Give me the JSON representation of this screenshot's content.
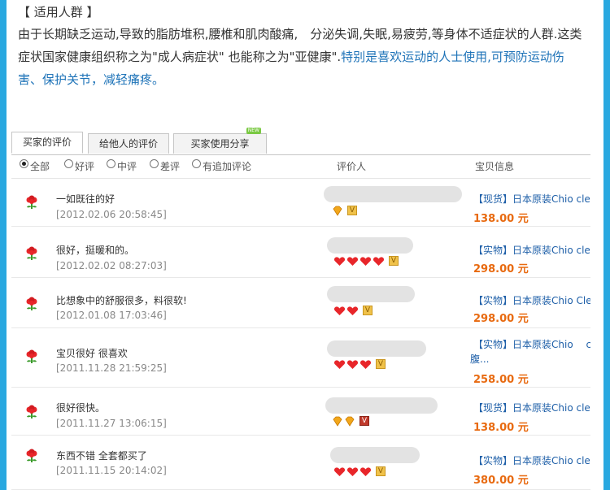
{
  "intro": {
    "heading": "【 适用人群 】",
    "body_part1": "由于长期缺乏运动,导致的脂肪堆积,腰椎和肌肉酸痛,　分泌失调,失眠,易疲劳,等身体不适症状的人群.这类症状国家健康组织称之为\"成人病症状\" 也能称之为\"亚健康\".",
    "body_highlight": "特别是喜欢运动的人士使用,可预防运动伤害、保护关节，减轻痛疼。"
  },
  "tabs": [
    {
      "label": "买家的评价",
      "active": true
    },
    {
      "label": "给他人的评价",
      "active": false
    },
    {
      "label": "买家使用分享",
      "active": false,
      "badge": "NEW"
    }
  ],
  "filters": [
    {
      "label": "全部",
      "checked": true
    },
    {
      "label": "好评",
      "checked": false
    },
    {
      "label": "中评",
      "checked": false
    },
    {
      "label": "差评",
      "checked": false
    },
    {
      "label": "有追加评论",
      "checked": false
    }
  ],
  "columns": {
    "reviewer": "评价人",
    "item": "宝贝信息"
  },
  "reviews": [
    {
      "comment": "一如既往的好",
      "date": "[2012.02.06 20:58:45]",
      "badge_type": "diamond",
      "badge_count": 1,
      "item": "【现货】日本原装Chio clear",
      "price": "138.00 元"
    },
    {
      "comment": "很好，挺暖和的。",
      "date": "[2012.02.02 08:27:03]",
      "badge_type": "heart",
      "badge_count": 4,
      "item": "【实物】日本原装Chio clea",
      "price": "298.00 元"
    },
    {
      "comment": "比想象中的舒服很多，料很软!",
      "date": "[2012.01.08 17:03:46]",
      "badge_type": "heart",
      "badge_count": 2,
      "item": "【实物】日本原装Chio Clea",
      "price": "298.00 元"
    },
    {
      "comment": "宝贝很好 很喜欢",
      "date": "[2011.11.28 21:59:25]",
      "badge_type": "heart",
      "badge_count": 3,
      "item": "【实物】日本原装Chio　 cle",
      "item_line2": "腹...",
      "price": "258.00 元"
    },
    {
      "comment": "很好很快。",
      "date": "[2011.11.27 13:06:15]",
      "badge_type": "diamond",
      "badge_count": 2,
      "item": "【现货】日本原装Chio clear",
      "price": "138.00 元"
    },
    {
      "comment": "东西不错 全套都买了",
      "date": "[2011.11.15 20:14:02]",
      "badge_type": "heart",
      "badge_count": 3,
      "item": "【实物】日本原装Chio clear",
      "price": "380.00 元"
    }
  ],
  "colors": {
    "accent_bar": "#29a8e0",
    "link": "#1e5fa8",
    "price": "#e86a10",
    "highlight_text": "#1e73b8"
  }
}
